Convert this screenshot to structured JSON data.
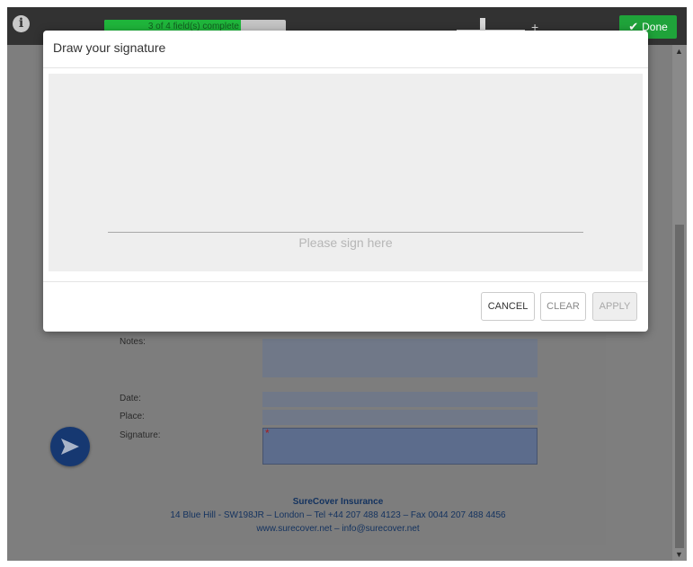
{
  "toolbar": {
    "info_icon": "info-icon",
    "progress": {
      "text": "3 of 4 field(s) complete",
      "completed": 3,
      "total": 4
    },
    "zoom_plus": "+",
    "done_label": "Done",
    "done_check": "✔"
  },
  "document": {
    "labels": {
      "notes": "Notes:",
      "date": "Date:",
      "place": "Place:",
      "signature": "Signature:"
    },
    "required_mark": "*",
    "footer": {
      "company": "SureCover Insurance",
      "address": "14 Blue Hill - SW198JR  –  London  –  Tel +44 207 488 4123  –  Fax 0044 207 488 4456",
      "web": "www.surecover.net  –  info@surecover.net"
    }
  },
  "modal": {
    "title": "Draw your signature",
    "hint": "Please sign here",
    "buttons": {
      "cancel": "CANCEL",
      "clear": "CLEAR",
      "apply": "APPLY"
    }
  },
  "colors": {
    "toolbar": "#323232",
    "progress_fill": "#1fb53b",
    "done": "#1fa33a",
    "send": "#163871",
    "canvas": "#eeeeee"
  }
}
